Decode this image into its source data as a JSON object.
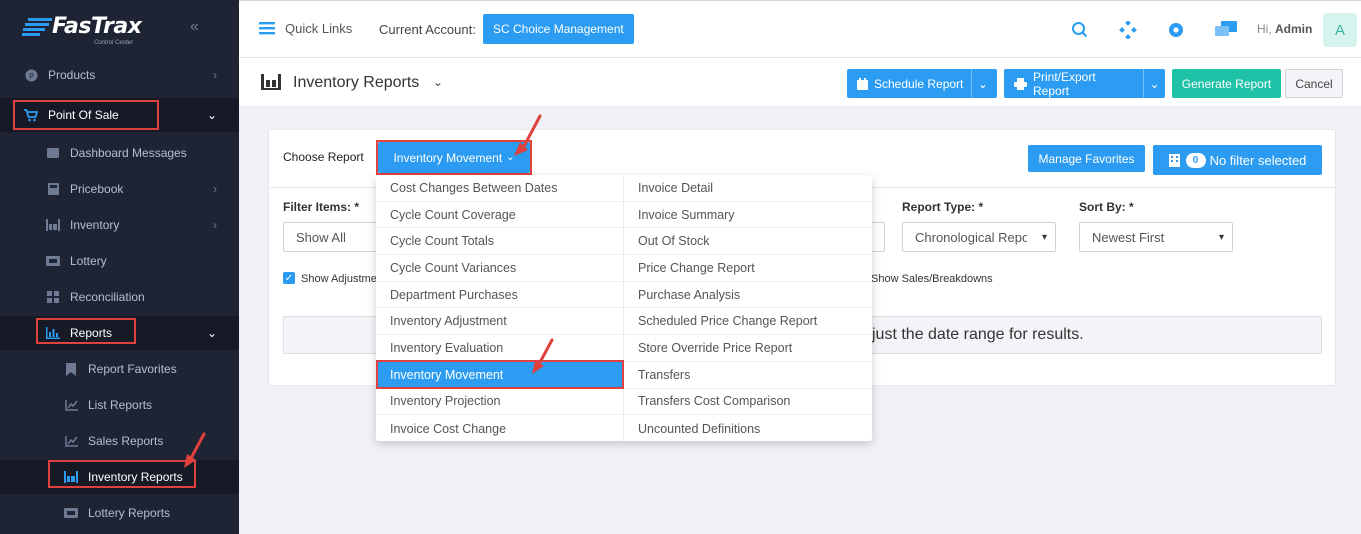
{
  "brand": {
    "name": "FasTrax",
    "sub": "Control Center"
  },
  "sidebar": {
    "items": [
      {
        "label": "Products"
      },
      {
        "label": "Point Of Sale"
      },
      {
        "label": "Dashboard Messages"
      },
      {
        "label": "Pricebook"
      },
      {
        "label": "Inventory"
      },
      {
        "label": "Lottery"
      },
      {
        "label": "Reconciliation"
      },
      {
        "label": "Reports"
      },
      {
        "label": "Report Favorites"
      },
      {
        "label": "List Reports"
      },
      {
        "label": "Sales Reports"
      },
      {
        "label": "Inventory Reports"
      },
      {
        "label": "Lottery Reports"
      }
    ]
  },
  "topbar": {
    "quick_links": "Quick Links",
    "current_account_label": "Current Account:",
    "current_account": "SC Choice Management",
    "greeting": "Hi,",
    "user": "Admin",
    "avatar_letter": "A"
  },
  "header": {
    "title": "Inventory Reports",
    "schedule": "Schedule Report",
    "print": "Print/Export Report",
    "generate": "Generate Report",
    "cancel": "Cancel"
  },
  "card": {
    "choose_report": "Choose Report",
    "selected_report": "Inventory Movement",
    "manage_favorites": "Manage Favorites",
    "filter_count": "0",
    "no_filter": "No filter selected",
    "filter_items_label": "Filter Items: *",
    "filter_items_value": "Show All",
    "report_type_label": "Report Type: *",
    "report_type_value": "Chronological Repo",
    "sort_by_label": "Sort By: *",
    "sort_by_value": "Newest First",
    "show_adjust": "Show Adjustme",
    "show_sales": "Show Sales/Breakdowns",
    "info_text": "just the date range for results."
  },
  "dropdown": {
    "left": [
      "Cost Changes Between Dates",
      "Cycle Count Coverage",
      "Cycle Count Totals",
      "Cycle Count Variances",
      "Department Purchases",
      "Inventory Adjustment",
      "Inventory Evaluation",
      "Inventory Movement",
      "Inventory Projection",
      "Invoice Cost Change"
    ],
    "right": [
      "Invoice Detail",
      "Invoice Summary",
      "Out Of Stock",
      "Price Change Report",
      "Purchase Analysis",
      "Scheduled Price Change Report",
      "Store Override Price Report",
      "Transfers",
      "Transfers Cost Comparison",
      "Uncounted Definitions"
    ]
  },
  "colors": {
    "primary": "#2b9cf2",
    "teal": "#1fc2a7",
    "highlight": "#e0413d",
    "sidebar_bg": "#1f2434"
  }
}
